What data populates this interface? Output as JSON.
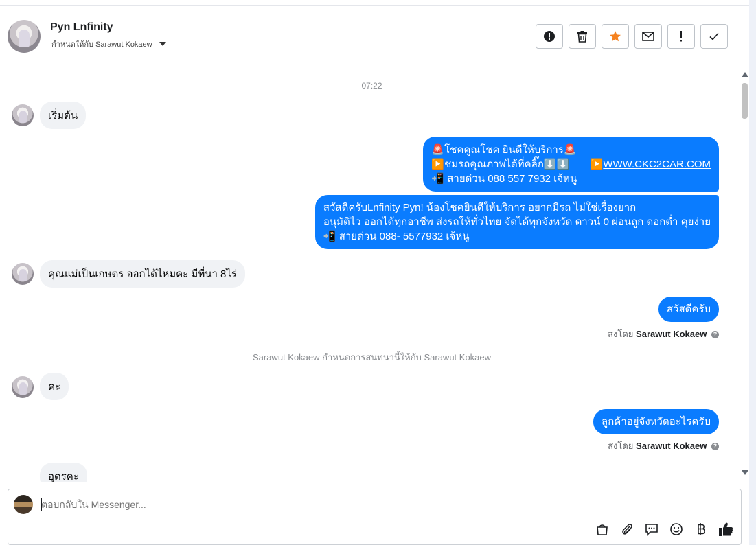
{
  "header": {
    "name": "Pyn Lnfinity",
    "assign_label": "กำหนดให้กับ Sarawut Kokaew"
  },
  "actions": [
    {
      "name": "spam-button",
      "icon": "alert-circle-icon"
    },
    {
      "name": "delete-button",
      "icon": "trash-icon"
    },
    {
      "name": "star-button",
      "icon": "star-icon",
      "color": "#f5821f"
    },
    {
      "name": "mark-unread-button",
      "icon": "envelope-icon"
    },
    {
      "name": "follow-up-button",
      "icon": "exclamation-icon"
    },
    {
      "name": "done-button",
      "icon": "check-icon"
    }
  ],
  "conversation": {
    "timestamp": "07:22",
    "messages": {
      "m1": "เริ่มต้น",
      "m2": {
        "line1": "🚨โชคคูณโชค ยินดีให้บริการ🚨",
        "line2": "▶️ชมรถคุณภาพได้ที่คลิ๊ก⬇️⬇️",
        "link_prefix": "▶️",
        "link": "WWW.CKC2CAR.COM",
        "line3": "📲 สายด่วน 088 557 7932 เจ้หนู"
      },
      "m3": {
        "line1": "สวัสดีครับLnfinity Pyn! น้องโชคยินดีให้บริการ อยากมีรถ ไม่ใช่เรื่องยาก",
        "line2": "อนุมัติไว ออกได้ทุกอาชีพ ส่งรถให้ทั่วไทย จัดได้ทุกจังหวัด ดาวน์ 0  ผ่อนถูก ดอกต่ำ คุยง่าย",
        "line3": "📲 สายด่วน 088- 5577932 เจ้หนู"
      },
      "m4": "คุณแม่เป็นเกษตร ออกได้ไหมคะ มีที่นา 8ไร่",
      "m5": "สวัสดีครับ",
      "m6": "คะ",
      "m7": "ลูกค้าอยู่จังหวัดอะไรครับ",
      "m8": "อุดรคะ"
    },
    "sent_by_prefix": "ส่งโดย",
    "sent_by_name": "Sarawut Kokaew",
    "help_glyph": "?",
    "system_note": "Sarawut Kokaew กำหนดการสนทนานี้ให้กับ Sarawut Kokaew"
  },
  "composer": {
    "placeholder": "ตอบกลับใน Messenger..."
  },
  "colors": {
    "outgoing": "#0a7cff",
    "incoming": "#f0f2f5",
    "star": "#f5821f"
  }
}
